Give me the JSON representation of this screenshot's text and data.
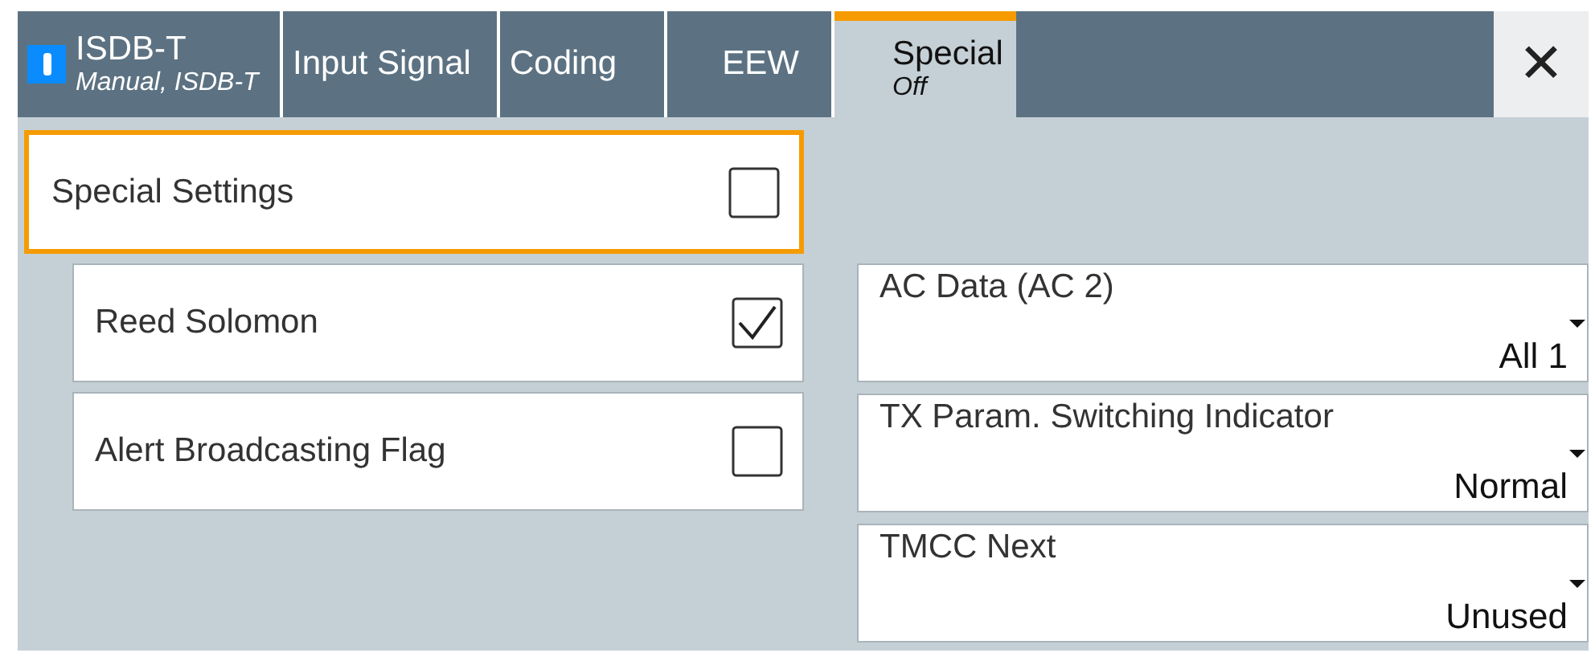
{
  "tabs": [
    {
      "label": "ISDB-T",
      "sublabel": "Manual, ISDB-T",
      "selected": false,
      "indicator": true
    },
    {
      "label": "Input Signal",
      "selected": false
    },
    {
      "label": "Coding",
      "selected": false
    },
    {
      "label": "EEW",
      "selected": false
    },
    {
      "label": "Special",
      "sublabel": "Off",
      "selected": true
    }
  ],
  "close_button": "✕",
  "main_setting": {
    "label": "Special Settings",
    "checked": false,
    "focused": true
  },
  "settings": [
    {
      "label": "Reed Solomon",
      "checked": true
    },
    {
      "label": "Alert Broadcasting Flag",
      "checked": false
    }
  ],
  "dropdowns": [
    {
      "label": "AC Data (AC 2)",
      "value": "All 1"
    },
    {
      "label": "TX Param. Switching Indicator",
      "value": "Normal"
    },
    {
      "label": "TMCC Next",
      "value": "Unused"
    }
  ]
}
